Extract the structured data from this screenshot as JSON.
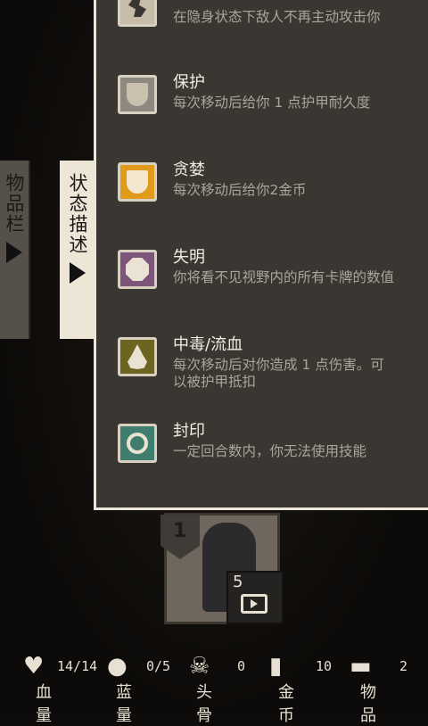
{
  "tabs": {
    "inventory": "物品栏",
    "status": "状态描述"
  },
  "effects": [
    {
      "name": "",
      "desc": "在隐身状态下敌人不再主动攻击你",
      "icon": "stealth-icon",
      "color": "#c7bca8"
    },
    {
      "name": "保护",
      "desc": "每次移动后给你 1 点护甲耐久度",
      "icon": "shield-icon",
      "color": "#8d8880",
      "inner": "#c9c0ad"
    },
    {
      "name": "贪婪",
      "desc": "每次移动后给你2金币",
      "icon": "greed-shield-icon",
      "color": "#e29a1a",
      "inner": "#f3e8cf"
    },
    {
      "name": "失明",
      "desc": "你将看不见视野内的所有卡牌的数值",
      "icon": "blind-icon",
      "color": "#7d557a",
      "inner": "#eae2d2"
    },
    {
      "name": "中毒/流血",
      "desc": "每次移动后对你造成 1 点伤害。可以被护甲抵扣",
      "icon": "poison-drop-icon",
      "color": "#6b6521",
      "inner": "#eae2d2"
    },
    {
      "name": "封印",
      "desc": "一定回合数内，你无法使用技能",
      "icon": "seal-icon",
      "color": "#3f7e6e",
      "inner": "#eae2d2"
    }
  ],
  "card": {
    "badge": "1",
    "counter": "5"
  },
  "stats": [
    {
      "icon": "heart-icon",
      "value": "14/14",
      "label": "血量"
    },
    {
      "icon": "mana-potion-icon",
      "value": "0/5",
      "label": "蓝量"
    },
    {
      "icon": "skull-icon",
      "value": "0",
      "label": "头骨"
    },
    {
      "icon": "coin-icon",
      "value": "10",
      "label": "金币"
    },
    {
      "icon": "chest-icon",
      "value": "2",
      "label": "物品"
    }
  ]
}
